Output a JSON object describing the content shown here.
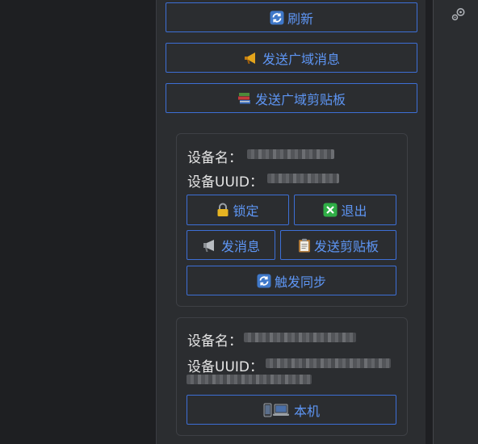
{
  "top_buttons": {
    "refresh": {
      "icon": "refresh-icon",
      "label": "刷新"
    },
    "send_broadcast_message": {
      "icon": "megaphone-icon",
      "label": "发送广域消息"
    },
    "send_broadcast_clipboard": {
      "icon": "books-icon",
      "label": "发送广域剪贴板"
    }
  },
  "devices": [
    {
      "name_label": "设备名：",
      "uuid_label": "设备UUID：",
      "actions": {
        "lock": {
          "icon": "lock-icon",
          "label": "锁定"
        },
        "logout": {
          "icon": "close-icon",
          "label": "退出"
        },
        "send_message": {
          "icon": "loudspeaker-icon",
          "label": "发消息"
        },
        "send_clipboard": {
          "icon": "clipboard-icon",
          "label": "发送剪贴板"
        },
        "trigger_sync": {
          "icon": "refresh-icon",
          "label": "触发同步"
        }
      }
    },
    {
      "name_label": "设备名：",
      "uuid_label": "设备UUID：",
      "actions": {
        "this_machine": {
          "icon": "phone-laptop-icon",
          "label": "本机"
        }
      }
    }
  ],
  "colors": {
    "accent": "#5e96f5",
    "button_border": "#3d6fd6",
    "panel_bg": "#2b2d30",
    "page_bg": "#1e1f22"
  },
  "right_bar": {
    "icon": "gear-icon"
  }
}
